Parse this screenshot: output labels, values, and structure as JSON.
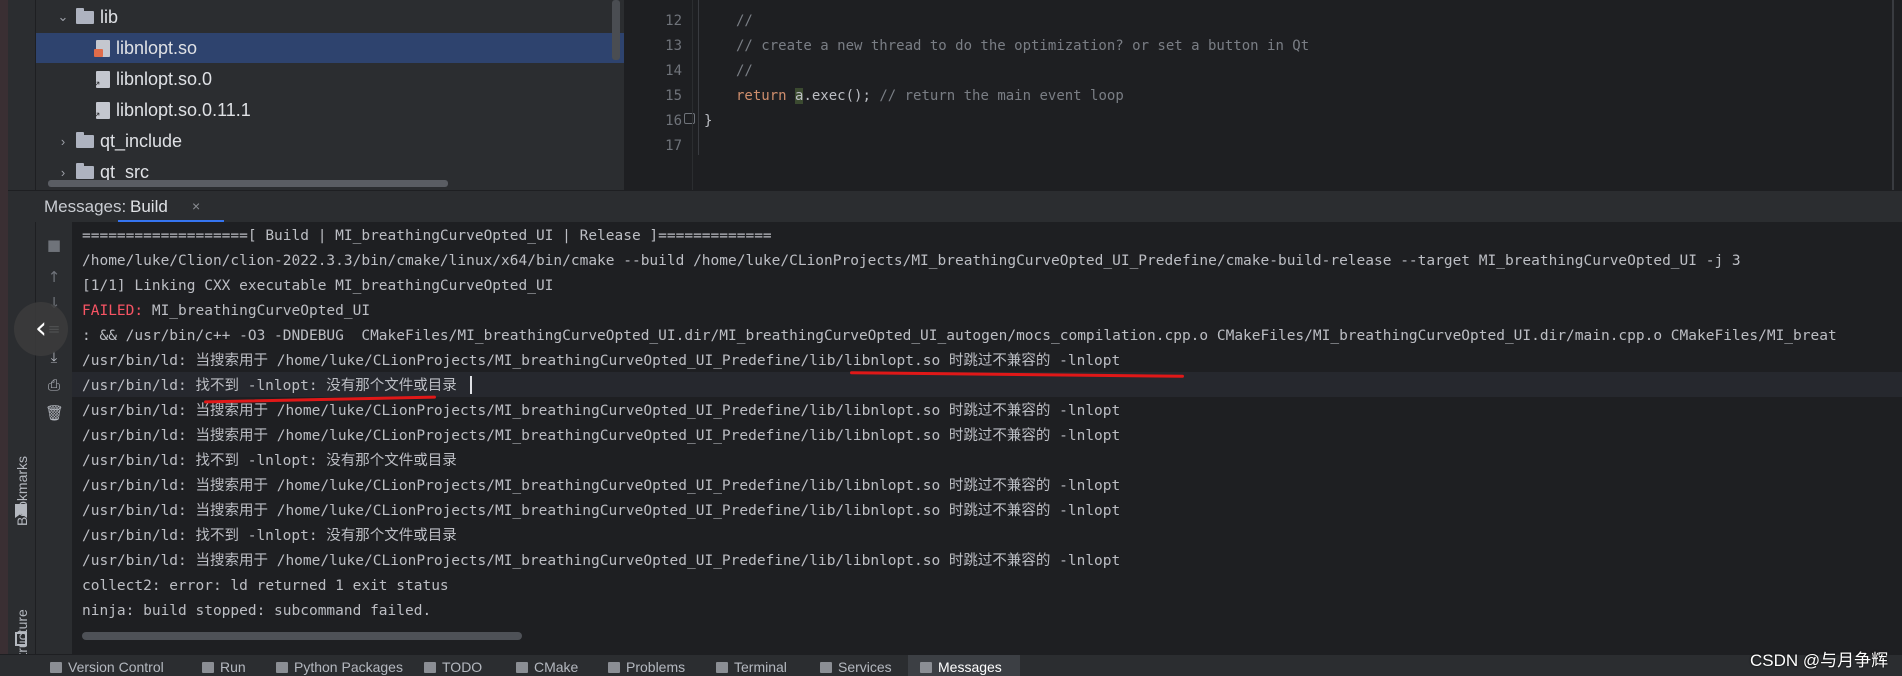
{
  "project_tree": {
    "items": [
      {
        "label": "lib",
        "kind": "folder",
        "expanded": true
      },
      {
        "label": "libnlopt.so",
        "kind": "so-file",
        "selected": true
      },
      {
        "label": "libnlopt.so.0",
        "kind": "link-file"
      },
      {
        "label": "libnlopt.so.0.11.1",
        "kind": "file"
      },
      {
        "label": "qt_include",
        "kind": "folder",
        "expanded": false
      },
      {
        "label": "qt_src",
        "kind": "folder",
        "expanded": false
      }
    ]
  },
  "editor": {
    "line_numbers": [
      "12",
      "13",
      "14",
      "15",
      "16",
      "17"
    ],
    "lines": {
      "l12": "//",
      "l13": "// create a new thread to do the optimization? or set a button in Qt",
      "l14": "//",
      "l15_kw": "return",
      "l15_var": "a",
      "l15_rest": ".exec(); ",
      "l15_comment": "// return the main event loop",
      "l16": "}"
    }
  },
  "messages": {
    "title": "Messages:",
    "tab": "Build",
    "tab_close": "×"
  },
  "console": {
    "lines": [
      "===================[ Build | MI_breathingCurveOpted_UI | Release ]=============",
      "/home/luke/Clion/clion-2022.3.3/bin/cmake/linux/x64/bin/cmake --build /home/luke/CLionProjects/MI_breathingCurveOpted_UI_Predefine/cmake-build-release --target MI_breathingCurveOpted_UI -j 3",
      "[1/1] Linking CXX executable MI_breathingCurveOpted_UI",
      "FAILED:",
      " MI_breathingCurveOpted_UI",
      ": && /usr/bin/c++ -O3 -DNDEBUG  CMakeFiles/MI_breathingCurveOpted_UI.dir/MI_breathingCurveOpted_UI_autogen/mocs_compilation.cpp.o CMakeFiles/MI_breathingCurveOpted_UI.dir/main.cpp.o CMakeFiles/MI_breat",
      "/usr/bin/ld: 当搜索用于 /home/luke/CLionProjects/MI_breathingCurveOpted_UI_Predefine/lib/libnlopt.so 时跳过不兼容的 -lnlopt",
      "/usr/bin/ld: 找不到 -lnlopt: 没有那个文件或目录",
      "/usr/bin/ld: 当搜索用于 /home/luke/CLionProjects/MI_breathingCurveOpted_UI_Predefine/lib/libnlopt.so 时跳过不兼容的 -lnlopt",
      "/usr/bin/ld: 当搜索用于 /home/luke/CLionProjects/MI_breathingCurveOpted_UI_Predefine/lib/libnlopt.so 时跳过不兼容的 -lnlopt",
      "/usr/bin/ld: 找不到 -lnlopt: 没有那个文件或目录",
      "/usr/bin/ld: 当搜索用于 /home/luke/CLionProjects/MI_breathingCurveOpted_UI_Predefine/lib/libnlopt.so 时跳过不兼容的 -lnlopt",
      "/usr/bin/ld: 当搜索用于 /home/luke/CLionProjects/MI_breathingCurveOpted_UI_Predefine/lib/libnlopt.so 时跳过不兼容的 -lnlopt",
      "/usr/bin/ld: 找不到 -lnlopt: 没有那个文件或目录",
      "/usr/bin/ld: 当搜索用于 /home/luke/CLionProjects/MI_breathingCurveOpted_UI_Predefine/lib/libnlopt.so 时跳过不兼容的 -lnlopt",
      "collect2: error: ld returned 1 exit status",
      "ninja: build stopped: subcommand failed."
    ]
  },
  "side_tabs": {
    "bookmarks": "Bookmarks",
    "structure": "Structure"
  },
  "bottom_bar": {
    "items": [
      "Version Control",
      "Run",
      "Python Packages",
      "TODO",
      "CMake",
      "Problems",
      "Terminal",
      "Services",
      "Messages"
    ]
  },
  "watermark": "CSDN @与月争辉",
  "colors": {
    "accent": "#3574f0",
    "error_text": "#f75464",
    "annotation_red": "#e01818",
    "selection": "#2e436e"
  }
}
